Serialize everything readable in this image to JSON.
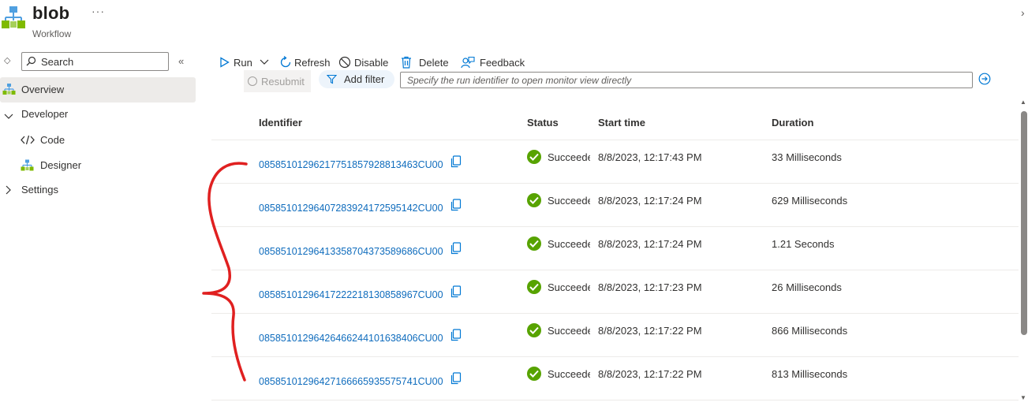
{
  "header": {
    "title": "blob",
    "subtitle": "Workflow",
    "more": "···",
    "close": "›"
  },
  "sidebar": {
    "search_placeholder": "Search",
    "items": [
      {
        "label": "Overview",
        "icon": "workflow-icon",
        "active": true
      },
      {
        "label": "Developer",
        "icon": "chevron-down-icon"
      },
      {
        "label": "Code",
        "icon": "code-icon"
      },
      {
        "label": "Designer",
        "icon": "designer-icon"
      },
      {
        "label": "Settings",
        "icon": "chevron-right-icon"
      }
    ]
  },
  "toolbar": {
    "run": "Run",
    "refresh": "Refresh",
    "disable": "Disable",
    "delete": "Delete",
    "feedback": "Feedback"
  },
  "filters": {
    "resubmit": "Resubmit",
    "add_filter": "Add filter",
    "run_id_placeholder": "Specify the run identifier to open monitor view directly"
  },
  "table": {
    "headers": {
      "identifier": "Identifier",
      "status": "Status",
      "start_time": "Start time",
      "duration": "Duration"
    },
    "rows": [
      {
        "identifier": "08585101296217751857928813463CU00",
        "status": "Succeeded",
        "start_time": "8/8/2023, 12:17:43 PM",
        "duration": "33 Milliseconds"
      },
      {
        "identifier": "08585101296407283924172595142CU00",
        "status": "Succeeded",
        "start_time": "8/8/2023, 12:17:24 PM",
        "duration": "629 Milliseconds"
      },
      {
        "identifier": "08585101296413358704373589686CU00",
        "status": "Succeeded",
        "start_time": "8/8/2023, 12:17:24 PM",
        "duration": "1.21 Seconds"
      },
      {
        "identifier": "08585101296417222218130858967CU00",
        "status": "Succeeded",
        "start_time": "8/8/2023, 12:17:23 PM",
        "duration": "26 Milliseconds"
      },
      {
        "identifier": "08585101296426466244101638406CU00",
        "status": "Succeeded",
        "start_time": "8/8/2023, 12:17:22 PM",
        "duration": "866 Milliseconds"
      },
      {
        "identifier": "08585101296427166665935575741CU00",
        "status": "Succeeded",
        "start_time": "8/8/2023, 12:17:22 PM",
        "duration": "813 Milliseconds"
      }
    ]
  },
  "colors": {
    "link": "#0f6cbd",
    "success": "#57a300",
    "annotation": "#e02020",
    "accent": "#0078d4"
  }
}
